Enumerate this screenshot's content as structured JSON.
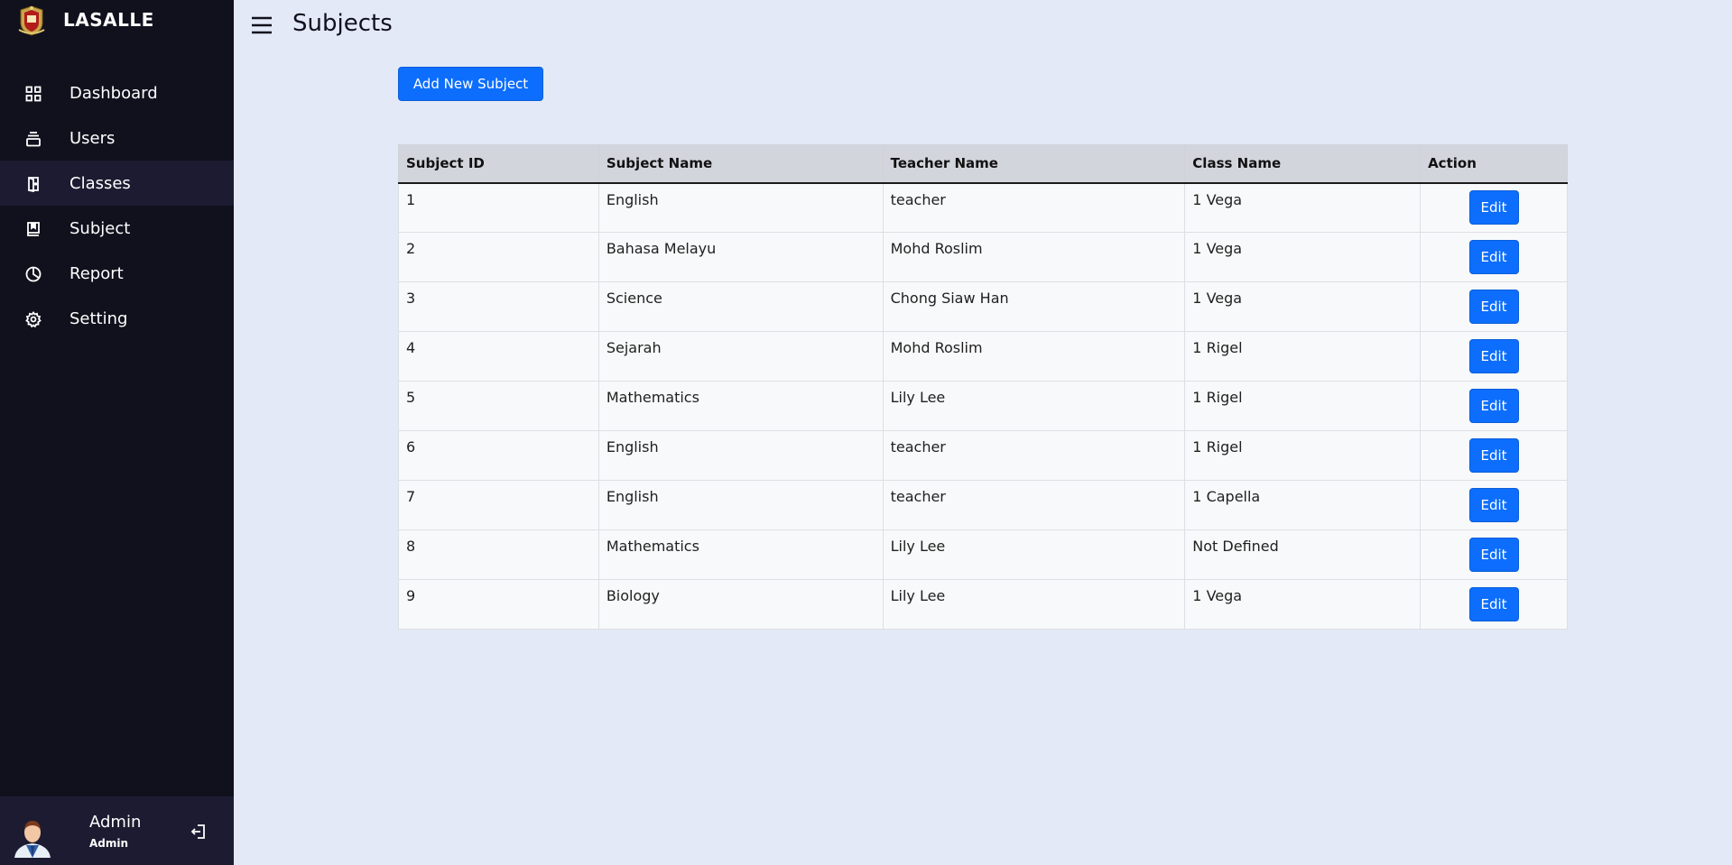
{
  "sidebar": {
    "brand": "LASALLE",
    "items": [
      {
        "label": "Dashboard",
        "icon": "grid-icon"
      },
      {
        "label": "Users",
        "icon": "users-icon"
      },
      {
        "label": "Classes",
        "icon": "classes-icon"
      },
      {
        "label": "Subject",
        "icon": "book-icon"
      },
      {
        "label": "Report",
        "icon": "pie-chart-icon"
      },
      {
        "label": "Setting",
        "icon": "gear-icon"
      }
    ],
    "active_item": "Classes",
    "profile": {
      "name": "Admin",
      "role": "Admin"
    }
  },
  "header": {
    "title": "Subjects"
  },
  "toolbar": {
    "add_label": "Add New Subject"
  },
  "table": {
    "columns": [
      "Subject ID",
      "Subject Name",
      "Teacher Name",
      "Class Name",
      "Action"
    ],
    "rows": [
      {
        "id": "1",
        "subject": "English",
        "teacher": "teacher",
        "class": "1 Vega",
        "action": "Edit"
      },
      {
        "id": "2",
        "subject": "Bahasa Melayu",
        "teacher": "Mohd Roslim",
        "class": "1 Vega",
        "action": "Edit"
      },
      {
        "id": "3",
        "subject": "Science",
        "teacher": "Chong Siaw Han",
        "class": "1 Vega",
        "action": "Edit"
      },
      {
        "id": "4",
        "subject": "Sejarah",
        "teacher": "Mohd Roslim",
        "class": "1 Rigel",
        "action": "Edit"
      },
      {
        "id": "5",
        "subject": "Mathematics",
        "teacher": "Lily Lee",
        "class": "1 Rigel",
        "action": "Edit"
      },
      {
        "id": "6",
        "subject": "English",
        "teacher": "teacher",
        "class": "1 Rigel",
        "action": "Edit"
      },
      {
        "id": "7",
        "subject": "English",
        "teacher": "teacher",
        "class": "1 Capella",
        "action": "Edit"
      },
      {
        "id": "8",
        "subject": "Mathematics",
        "teacher": "Lily Lee",
        "class": "Not Defined",
        "action": "Edit"
      },
      {
        "id": "9",
        "subject": "Biology",
        "teacher": "Lily Lee",
        "class": "1 Vega",
        "action": "Edit"
      }
    ]
  },
  "colors": {
    "sidebar_bg": "#11101d",
    "active_bg": "#1d1b31",
    "page_bg": "#e4e9f7",
    "primary": "#0d6efd"
  }
}
